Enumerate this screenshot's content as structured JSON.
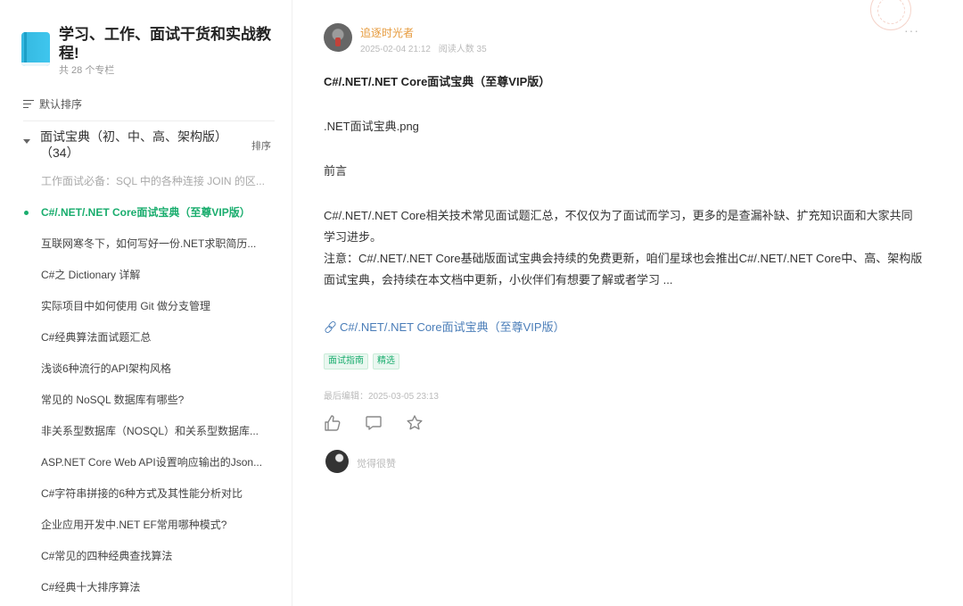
{
  "sidebar": {
    "title": "学习、工作、面试干货和实战教程!",
    "count": "共 28 个专栏",
    "sort_label": "默认排序",
    "group_title": "面试宝典（初、中、高、架构版）（34）",
    "group_sort": "排序",
    "items": [
      {
        "label": "工作面试必备：SQL 中的各种连接 JOIN 的区...",
        "state": "muted"
      },
      {
        "label": "C#/.NET/.NET Core面试宝典（至尊VIP版）",
        "state": "active"
      },
      {
        "label": "互联网寒冬下，如何写好一份.NET求职简历...",
        "state": "normal"
      },
      {
        "label": "C#之 Dictionary 详解",
        "state": "normal"
      },
      {
        "label": "实际项目中如何使用 Git 做分支管理",
        "state": "normal"
      },
      {
        "label": "C#经典算法面试题汇总",
        "state": "normal"
      },
      {
        "label": "浅谈6种流行的API架构风格",
        "state": "normal"
      },
      {
        "label": "常见的 NoSQL 数据库有哪些?",
        "state": "normal"
      },
      {
        "label": "非关系型数据库（NOSQL）和关系型数据库...",
        "state": "normal"
      },
      {
        "label": "ASP.NET Core Web API设置响应输出的Json...",
        "state": "normal"
      },
      {
        "label": "C#字符串拼接的6种方式及其性能分析对比",
        "state": "normal"
      },
      {
        "label": "企业应用开发中.NET EF常用哪种模式?",
        "state": "normal"
      },
      {
        "label": "C#常见的四种经典查找算法",
        "state": "normal"
      },
      {
        "label": "C#经典十大排序算法",
        "state": "normal"
      }
    ]
  },
  "post": {
    "author": "追逐时光者",
    "date": "2025-02-04 21:12",
    "reads": "阅读人数 35",
    "more": "···",
    "title": "C#/.NET/.NET Core面试宝典（至尊VIP版）",
    "image_name": ".NET面试宝典.png",
    "preface": "前言",
    "body_1": "C#/.NET/.NET Core相关技术常见面试题汇总，不仅仅为了面试而学习，更多的是查漏补缺、扩充知识面和大家共同学习进步。",
    "body_2": "注意：C#/.NET/.NET Core基础版面试宝典会持续的免费更新，咱们星球也会推出C#/.NET/.NET Core中、高、架构版面试宝典，会持续在本文档中更新，小伙伴们有想要了解或者学习 ...",
    "link": "C#/.NET/.NET Core面试宝典（至尊VIP版）",
    "tags": [
      "面试指南",
      "精选"
    ],
    "last_edited": "最后编辑：2025-03-05 23:13",
    "liker": "觉得很赞"
  },
  "colors": {
    "accent": "#1aad6e",
    "author": "#e69a3c",
    "link": "#4a7db8"
  },
  "icons": [
    "book-icon",
    "sort-icon",
    "caret-down-icon",
    "link-icon",
    "like-icon",
    "comment-icon",
    "star-icon",
    "more-icon"
  ]
}
